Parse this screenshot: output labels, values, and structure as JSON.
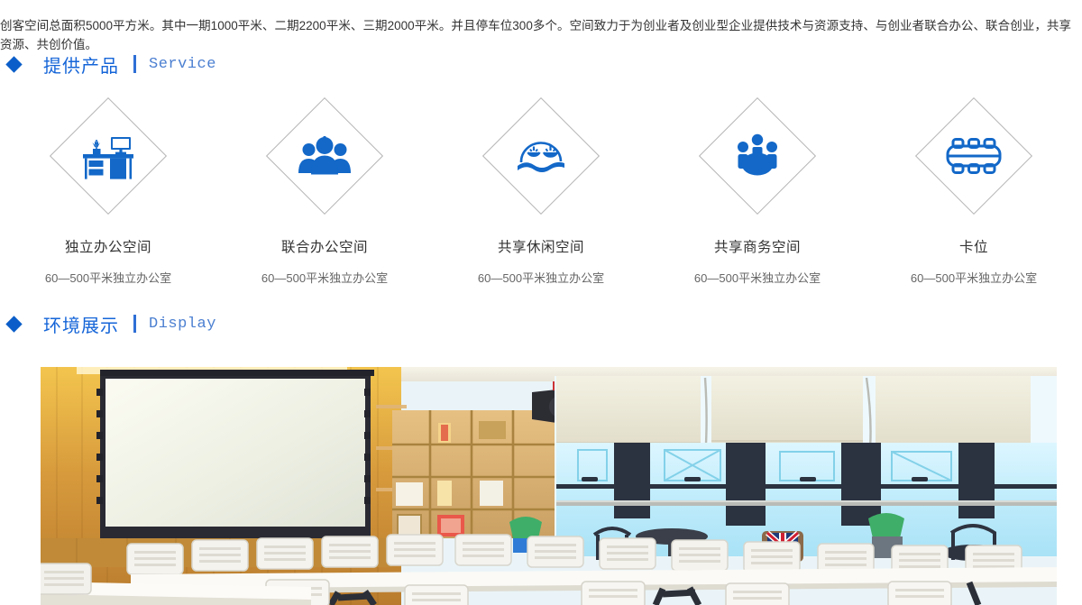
{
  "intro": {
    "text": "创客空间总面积5000平方米。其中一期1000平米、二期2200平米、三期2000平米。并且停车位300多个。空间致力于为创业者及创业型企业提供技术与资源支持、与创业者联合办公、联合创业，共享资源、共创价值。"
  },
  "colors": {
    "accent_blue": "#1565d8",
    "bullet_blue": "#0b5ec9",
    "icon_blue": "#1368c8",
    "en_blue": "#4b7fd1",
    "frame_gray": "#b4b4b4",
    "body_text": "#333333",
    "sub_text": "#666666"
  },
  "sections": [
    {
      "id": "service",
      "bullet_icon": "diamond-bullet-icon",
      "title_cn": "提供产品",
      "separator": "|",
      "title_en": "Service"
    },
    {
      "id": "display",
      "bullet_icon": "diamond-bullet-icon",
      "title_cn": "环境展示",
      "separator": "|",
      "title_en": "Display"
    }
  ],
  "products": [
    {
      "icon": "desk-monitor-icon",
      "title": "独立办公空间",
      "subtitle": "60—500平米独立办公室"
    },
    {
      "icon": "people-group-icon",
      "title": "联合办公空间",
      "subtitle": "60—500平米独立办公室"
    },
    {
      "icon": "leisure-face-wave-icon",
      "title": "共享休闲空间",
      "subtitle": "60—500平米独立办公室"
    },
    {
      "icon": "meeting-round-table-icon",
      "title": "共享商务空间",
      "subtitle": "60—500平米独立办公室"
    },
    {
      "icon": "workstation-seats-icon",
      "title": "卡位",
      "subtitle": "60—500平米独立办公室"
    }
  ],
  "photo": {
    "alt": "创客空间会议培训室实景：木质墙面、投影幕布、书架、白色桌椅、落地窗卷帘",
    "name": "environment-photo"
  }
}
